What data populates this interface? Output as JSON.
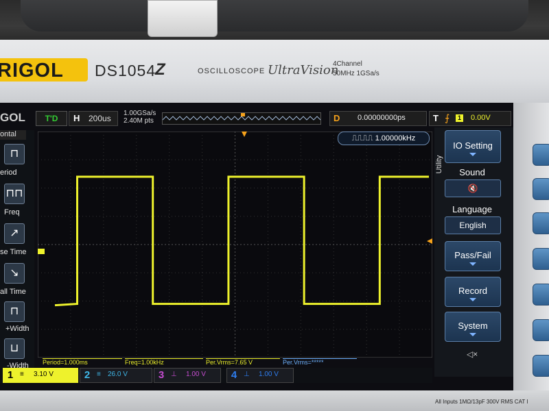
{
  "device": {
    "brand": "RIGOL",
    "model": "DS1054",
    "model_suffix": "Z",
    "category": "OSCILLOSCOPE",
    "series": "UltraVision",
    "spec_channels": "4Channel",
    "spec_bandwidth": "50MHz 1GSa/s",
    "inputs_label": "All Inputs 1MΩ/13pF 300V RMS CAT I"
  },
  "screen": {
    "logo": "GOL",
    "run_state": "T'D",
    "timebase_label": "H",
    "timebase_value": "200us",
    "sample_rate": "1.00GSa/s",
    "memory_depth": "2.40M pts",
    "delay_label": "D",
    "delay_value": "0.00000000ps",
    "trigger_label": "T",
    "trigger_edge": "⨍",
    "trigger_source": "1",
    "trigger_level": "0.00V",
    "trigger_marker": "T",
    "counter_value": "1.00000kHz"
  },
  "left_menu": {
    "title": "ontal",
    "items": [
      {
        "icon": "⊓",
        "label": "eriod"
      },
      {
        "icon": "⊓⊓",
        "label": "Freq"
      },
      {
        "icon": "↗",
        "label": "se Time"
      },
      {
        "icon": "↘",
        "label": "all Time"
      },
      {
        "icon": "⊓",
        "label": "+Width"
      },
      {
        "icon": "⊔",
        "label": "-Width"
      }
    ]
  },
  "right_menu": {
    "section": "Utility",
    "io_setting": "IO Setting",
    "sound_label": "Sound",
    "sound_icon": "speaker-muted",
    "language_label": "Language",
    "language_value": "English",
    "pass_fail": "Pass/Fail",
    "record": "Record",
    "system": "System"
  },
  "measurements": [
    {
      "text": "Period=1.000ms"
    },
    {
      "text": "Freq=1.00kHz"
    },
    {
      "text": "Per.Vrms=7.65 V"
    },
    {
      "text": "Per.Vrms=*****"
    }
  ],
  "channels": [
    {
      "num": "1",
      "coupling": "≡",
      "value": "3.10 V",
      "color": "#eef22c"
    },
    {
      "num": "2",
      "coupling": "≡",
      "value": "26.0 V",
      "color": "#3fb7e8"
    },
    {
      "num": "3",
      "coupling": "⊥",
      "value": "1.00 V",
      "color": "#c44ccf"
    },
    {
      "num": "4",
      "coupling": "⊥",
      "value": "1.00 V",
      "color": "#2f7ef0"
    }
  ],
  "waveform": {
    "type": "square",
    "color": "#eef22c",
    "frequency_khz": 1.0,
    "high_level_div": 2.4,
    "low_level_div": -2.1,
    "duty": 0.5
  }
}
